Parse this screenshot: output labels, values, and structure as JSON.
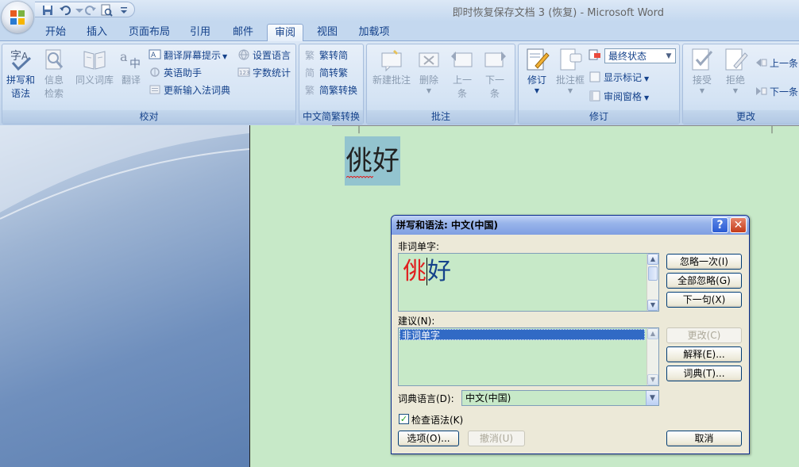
{
  "window": {
    "title": "即时恢复保存文档 3 (恢复) - Microsoft Word"
  },
  "tabs": [
    {
      "label": "开始"
    },
    {
      "label": "插入"
    },
    {
      "label": "页面布局"
    },
    {
      "label": "引用"
    },
    {
      "label": "邮件"
    },
    {
      "label": "审阅",
      "active": true
    },
    {
      "label": "视图"
    },
    {
      "label": "加载项"
    }
  ],
  "ribbon": {
    "proofing": {
      "label": "校对",
      "spelling": "拼写和\n语法",
      "research": "信息\n检索",
      "thesaurus": "同义词库",
      "translate": "翻译",
      "translate_tip": "翻译屏幕提示",
      "english_assistant": "英语助手",
      "ime_dictionary": "更新输入法词典",
      "set_language": "设置语言",
      "word_count": "字数统计"
    },
    "chinese_conversion": {
      "label": "中文简繁转换",
      "to_simplified": "繁转简",
      "to_traditional": "简转繁",
      "conversion": "简繁转换"
    },
    "comments": {
      "label": "批注",
      "new_comment": "新建批注",
      "delete": "删除",
      "previous": "上一\n条",
      "next": "下一\n条"
    },
    "tracking": {
      "label": "修订",
      "track_changes": "修订",
      "balloons": "批注框",
      "display_mode": "最终状态",
      "show_markup": "显示标记",
      "reviewing_pane": "审阅窗格"
    },
    "changes": {
      "label": "更改",
      "accept": "接受",
      "reject": "拒绝",
      "previous": "上一条",
      "next": "下一条"
    }
  },
  "document": {
    "text": "佻好"
  },
  "dialog": {
    "title": "拼写和语法: 中文(中国)",
    "not_in_dictionary_label": "非词单字:",
    "flagged_char": "佻",
    "rest_text": "好",
    "suggestions_label": "建议(N):",
    "suggestion_item": "非词单字",
    "dictionary_language_label": "词典语言(D):",
    "dictionary_language_value": "中文(中国)",
    "check_grammar_label": "检查语法(K)",
    "buttons": {
      "ignore_once": "忽略一次(I)",
      "ignore_all": "全部忽略(G)",
      "next_sentence": "下一句(X)",
      "change": "更改(C)",
      "explain": "解释(E)...",
      "dictionary": "词典(T)...",
      "options": "选项(O)...",
      "undo": "撤消(U)",
      "cancel": "取消"
    },
    "help_glyph": "?",
    "close_glyph": "✕"
  },
  "colors": {
    "accent": "#15428b",
    "flagged": "#e02020",
    "document_bg": "#c7e9c8",
    "selection": "#316ac5"
  }
}
